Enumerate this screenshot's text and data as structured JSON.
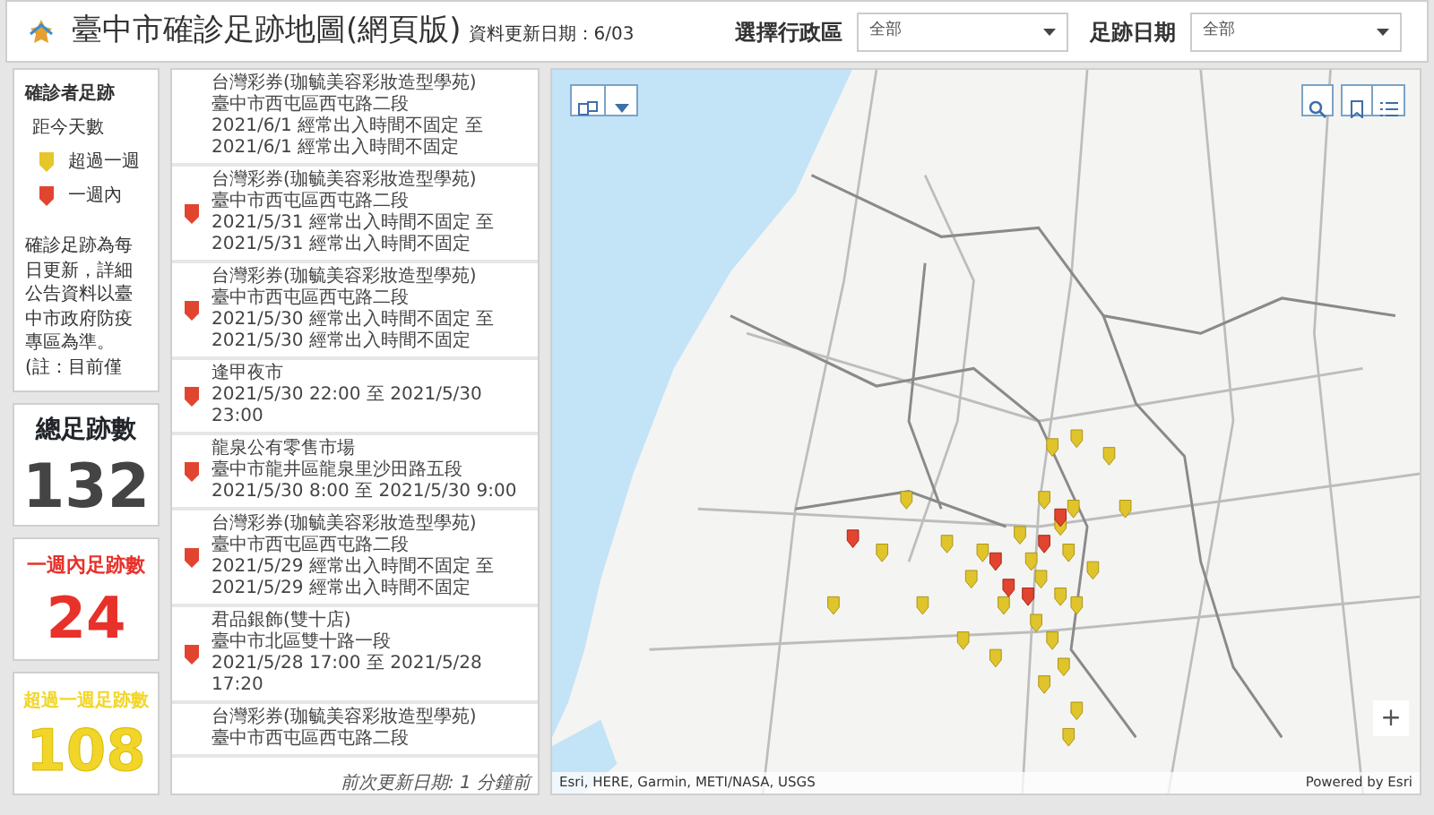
{
  "header": {
    "title": "臺中市確診足跡地圖(網頁版)",
    "updated": "資料更新日期：6/03",
    "filters": [
      {
        "label": "選擇行政區",
        "value": "全部"
      },
      {
        "label": "足跡日期",
        "value": "全部"
      }
    ]
  },
  "legend": {
    "title": "確診者足跡",
    "subtitle": "距今天數",
    "items": [
      {
        "label": "超過一週",
        "color": "#e6c62a"
      },
      {
        "label": "一週內",
        "color": "#e2452f"
      }
    ],
    "note": "確診足跡為每日更新，詳細公告資料以臺中市政府防疫專區為準。(註：目前僅"
  },
  "stats": [
    {
      "label": "總足跡數",
      "value": "132",
      "color": "#444444"
    },
    {
      "label": "一週內足跡數",
      "value": "24",
      "color": "#e8312a"
    },
    {
      "label": "超過一週足跡數",
      "value": "108",
      "color": "#f1d629"
    }
  ],
  "footprints": [
    {
      "name": "台灣彩券(珈毓美容彩妝造型學苑)",
      "address": "臺中市西屯區西屯路二段",
      "time": "2021/6/1 經常出入時間不固定 至 2021/6/1 經常出入時間不固定"
    },
    {
      "name": "台灣彩券(珈毓美容彩妝造型學苑)",
      "address": "臺中市西屯區西屯路二段",
      "time": "2021/5/31 經常出入時間不固定 至 2021/5/31 經常出入時間不固定",
      "color": "#e2452f"
    },
    {
      "name": "台灣彩券(珈毓美容彩妝造型學苑)",
      "address": "臺中市西屯區西屯路二段",
      "time": "2021/5/30 經常出入時間不固定 至 2021/5/30 經常出入時間不固定",
      "color": "#e2452f"
    },
    {
      "name": "逢甲夜市",
      "time": "2021/5/30 22:00 至 2021/5/30 23:00",
      "color": "#e2452f"
    },
    {
      "name": "龍泉公有零售市場",
      "address": "臺中市龍井區龍泉里沙田路五段",
      "time": "2021/5/30 8:00 至 2021/5/30 9:00",
      "color": "#e2452f"
    },
    {
      "name": "台灣彩券(珈毓美容彩妝造型學苑)",
      "address": "臺中市西屯區西屯路二段",
      "time": "2021/5/29 經常出入時間不固定 至 2021/5/29 經常出入時間不固定",
      "color": "#e2452f"
    },
    {
      "name": "君品銀飾(雙十店)",
      "address": "臺中市北區雙十路一段",
      "time": "2021/5/28 17:00 至 2021/5/28 17:20",
      "color": "#e2452f"
    },
    {
      "name": "台灣彩券(珈毓美容彩妝造型學苑)",
      "address": "臺中市西屯區西屯路二段"
    }
  ],
  "list_footer": "前次更新日期: 1 分鐘前",
  "map": {
    "zoom_in": "+",
    "attribution": "Esri, HERE, Garmin, METI/NASA, USGS",
    "powered_by": "Powered by Esri"
  }
}
